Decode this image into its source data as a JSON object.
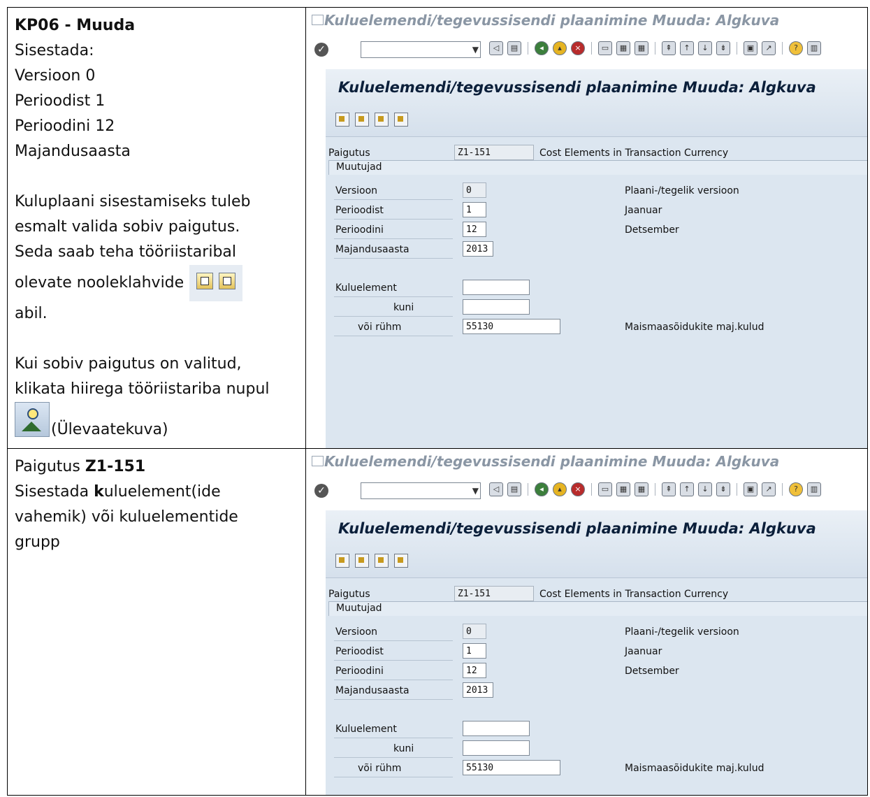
{
  "row1": {
    "title": "KP06 - Muuda",
    "lines": [
      "Sisestada:",
      "Versioon 0",
      "Perioodist 1",
      "Perioodini 12",
      "Majandusaasta"
    ],
    "para1": [
      "Kuluplaani sisestamiseks tuleb",
      "esmalt valida sobiv paigutus.",
      "Seda saab teha tööriistaribal"
    ],
    "para1_arrows_line": "olevate nooleklahvide",
    "para1_end": "abil.",
    "para2": [
      "Kui sobiv paigutus on valitud,",
      "klikata hiirega tööriistariba nupul"
    ],
    "para2_icon_caption": "(Ülevaatekuva)"
  },
  "row2": {
    "line1_prefix": "Paigutus ",
    "line1_bold": "Z1-151",
    "line2_prefix": "Sisestada ",
    "line2_bold": "k",
    "line2_rest": "uluelement(ide",
    "line3": "vahemik) või kuluelementide",
    "line4": "grupp"
  },
  "sap": {
    "window_title": "Kuluelemendi/tegevussisendi plaanimine Muuda: Algkuva",
    "heading": "Kuluelemendi/tegevussisendi plaanimine Muuda: Algkuva",
    "layout_label": "Paigutus",
    "layout_value": "Z1-151",
    "layout_desc": "Cost Elements in Transaction Currency",
    "group_title": "Muutujad",
    "version_label": "Versioon",
    "version_value": "0",
    "version_desc": "Plaani-/tegelik versioon",
    "from_label": "Perioodist",
    "from_value": "1",
    "from_desc": "Jaanuar",
    "to_label": "Perioodini",
    "to_value": "12",
    "to_desc": "Detsember",
    "year_label": "Majandusaasta",
    "year_value": "2013",
    "costel_label": "Kuluelement",
    "costel_value": "",
    "to2_label": "kuni",
    "to2_value": "",
    "group_label": "või rühm",
    "group_value": "55130",
    "group_desc": "Maismaasõidukite maj.kulud"
  }
}
